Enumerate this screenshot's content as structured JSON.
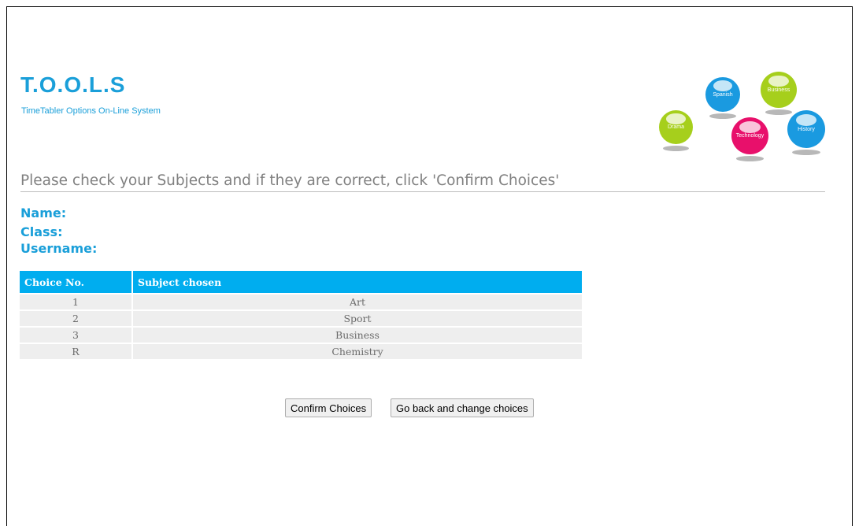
{
  "header": {
    "logo_title": "T.O.O.L.S",
    "logo_subtitle": "TimeTabler Options On-Line System",
    "balls": [
      {
        "label": "Spanish",
        "color": "#1a9ae0"
      },
      {
        "label": "Business",
        "color": "#a6cf1c"
      },
      {
        "label": "Drama",
        "color": "#a6cf1c"
      },
      {
        "label": "Technology",
        "color": "#e8106b"
      },
      {
        "label": "History",
        "color": "#1a9ae0"
      }
    ]
  },
  "main": {
    "heading": "Please check your Subjects and if they are correct, click 'Confirm Choices'",
    "info": {
      "name_label": "Name:",
      "class_label": "Class:",
      "username_label": "Username:"
    },
    "table": {
      "columns": [
        "Choice No.",
        "Subject chosen"
      ],
      "rows": [
        {
          "choice": "1",
          "subject": "Art"
        },
        {
          "choice": "2",
          "subject": "Sport"
        },
        {
          "choice": "3",
          "subject": "Business"
        },
        {
          "choice": "R",
          "subject": "Chemistry"
        }
      ]
    },
    "buttons": {
      "confirm": "Confirm Choices",
      "go_back": "Go back and change choices"
    }
  },
  "colors": {
    "accent": "#1a9fd9",
    "table_header": "#00adef",
    "row_background": "#eeeeee"
  }
}
